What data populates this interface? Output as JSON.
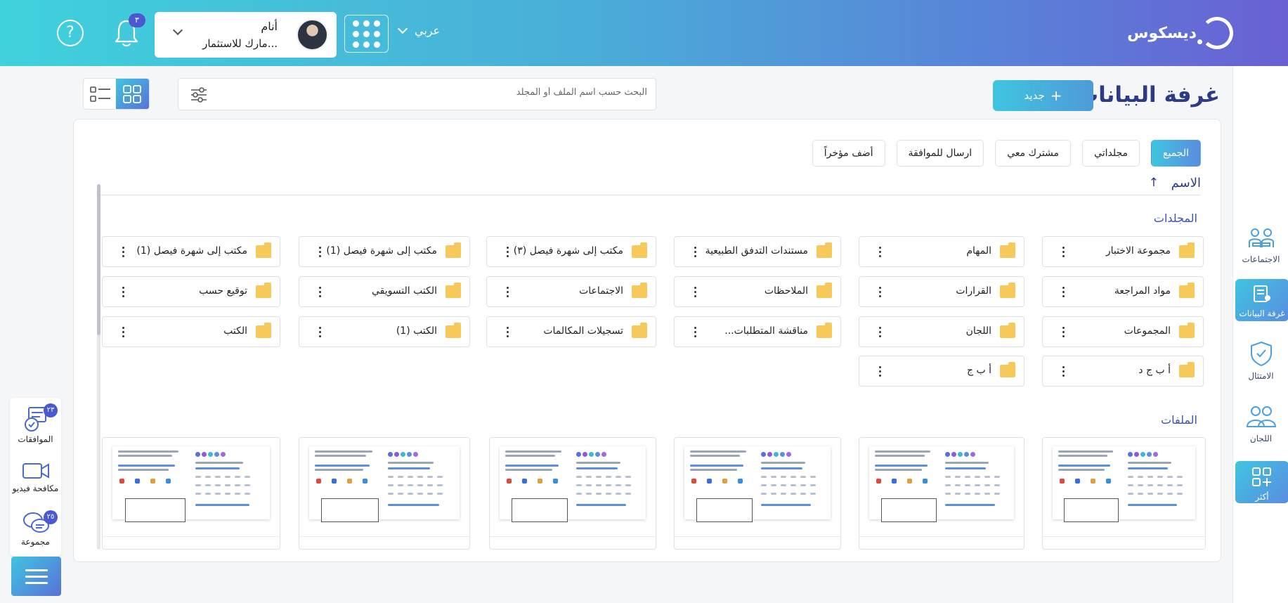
{
  "header": {
    "logo_text": "ديسكوس",
    "language": "عربي",
    "user": {
      "name": "أنام",
      "org": "مارك للاستثمار..."
    },
    "notifications_count": "٣"
  },
  "right_sidebar": {
    "items": [
      {
        "label": "الاجتماعات",
        "icon": "meetings-icon"
      },
      {
        "label": "غرفة البيانات",
        "icon": "data-room-icon",
        "active": true
      },
      {
        "label": "الامتثال",
        "icon": "compliance-icon"
      },
      {
        "label": "اللجان",
        "icon": "committees-icon"
      },
      {
        "label": "أكثر",
        "icon": "more-icon"
      }
    ]
  },
  "left_panel": {
    "approvals": {
      "label": "الموافقات",
      "badge": "٢٣"
    },
    "video": {
      "label": "مكافحة فيديو"
    },
    "group": {
      "label": "مجموعة",
      "badge": "٢٥"
    }
  },
  "page": {
    "title": "غرفة البيانات",
    "new_button": "جديد",
    "search_placeholder": "البحث حسب اسم الملف أو المجلد"
  },
  "tabs": [
    "الجميع",
    "مجلداتي",
    "مشترك معي",
    "ارسال للموافقة",
    "أضف مؤخراً"
  ],
  "sort": {
    "label": "الاسم"
  },
  "folders_title": "المجلدات",
  "files_title": "الملفات",
  "folders": [
    [
      "مجموعة الاختبار",
      "المهام",
      "مستندات التدفق الطبيعية",
      "مكتب إلى شهرة فيصل (٣)",
      "مكتب إلى شهرة فيصل (1)",
      "مكتب إلى شهرة فيصل (1)"
    ],
    [
      "مواد المراجعة",
      "القرارات",
      "الملاحظات",
      "الاجتماعات",
      "الكتب التسويقي",
      "توقيع حسب"
    ],
    [
      "المجموعات",
      "اللجان",
      "مناقشة المتطلبات...",
      "تسجيلات المكالمات",
      "الكتب (1)",
      "الكتب"
    ],
    [
      "أ ب ج د",
      "أ ب ج"
    ]
  ],
  "colors": {
    "brand": "#4aaed8",
    "accent": "#5a70d8",
    "title": "#2d3b87",
    "folder": "#f7c85a"
  }
}
